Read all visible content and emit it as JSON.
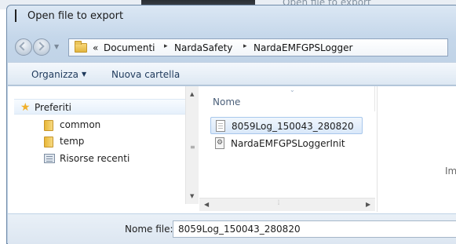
{
  "background": {
    "behind_window_title": "Open file to export"
  },
  "window": {
    "title": "Open file to export"
  },
  "address_bar": {
    "prefix": "«",
    "crumbs": [
      "Documenti",
      "NardaSafety",
      "NardaEMFGPSLogger"
    ],
    "separator": "▸"
  },
  "toolbar": {
    "organize_label": "Organizza",
    "new_folder_label": "Nuova cartella"
  },
  "nav_pane": {
    "favorites_label": "Preferiti",
    "items": [
      "common",
      "temp",
      "Risorse recenti"
    ]
  },
  "file_list": {
    "column_name": "Nome",
    "files": [
      {
        "name": "8059Log_150043_280820",
        "selected": true,
        "icon": "text-file-icon"
      },
      {
        "name": "NardaEMFGPSLoggerInit",
        "selected": false,
        "icon": "config-file-icon"
      }
    ]
  },
  "preview": {
    "text": "Imp"
  },
  "filename": {
    "label": "Nome file:",
    "value": "8059Log_150043_280820"
  },
  "colors": {
    "window_frame": "#bfd2e6",
    "selection": "#d9e8f9",
    "toolbar_text": "#1e395b",
    "folder": "#e8b738"
  }
}
